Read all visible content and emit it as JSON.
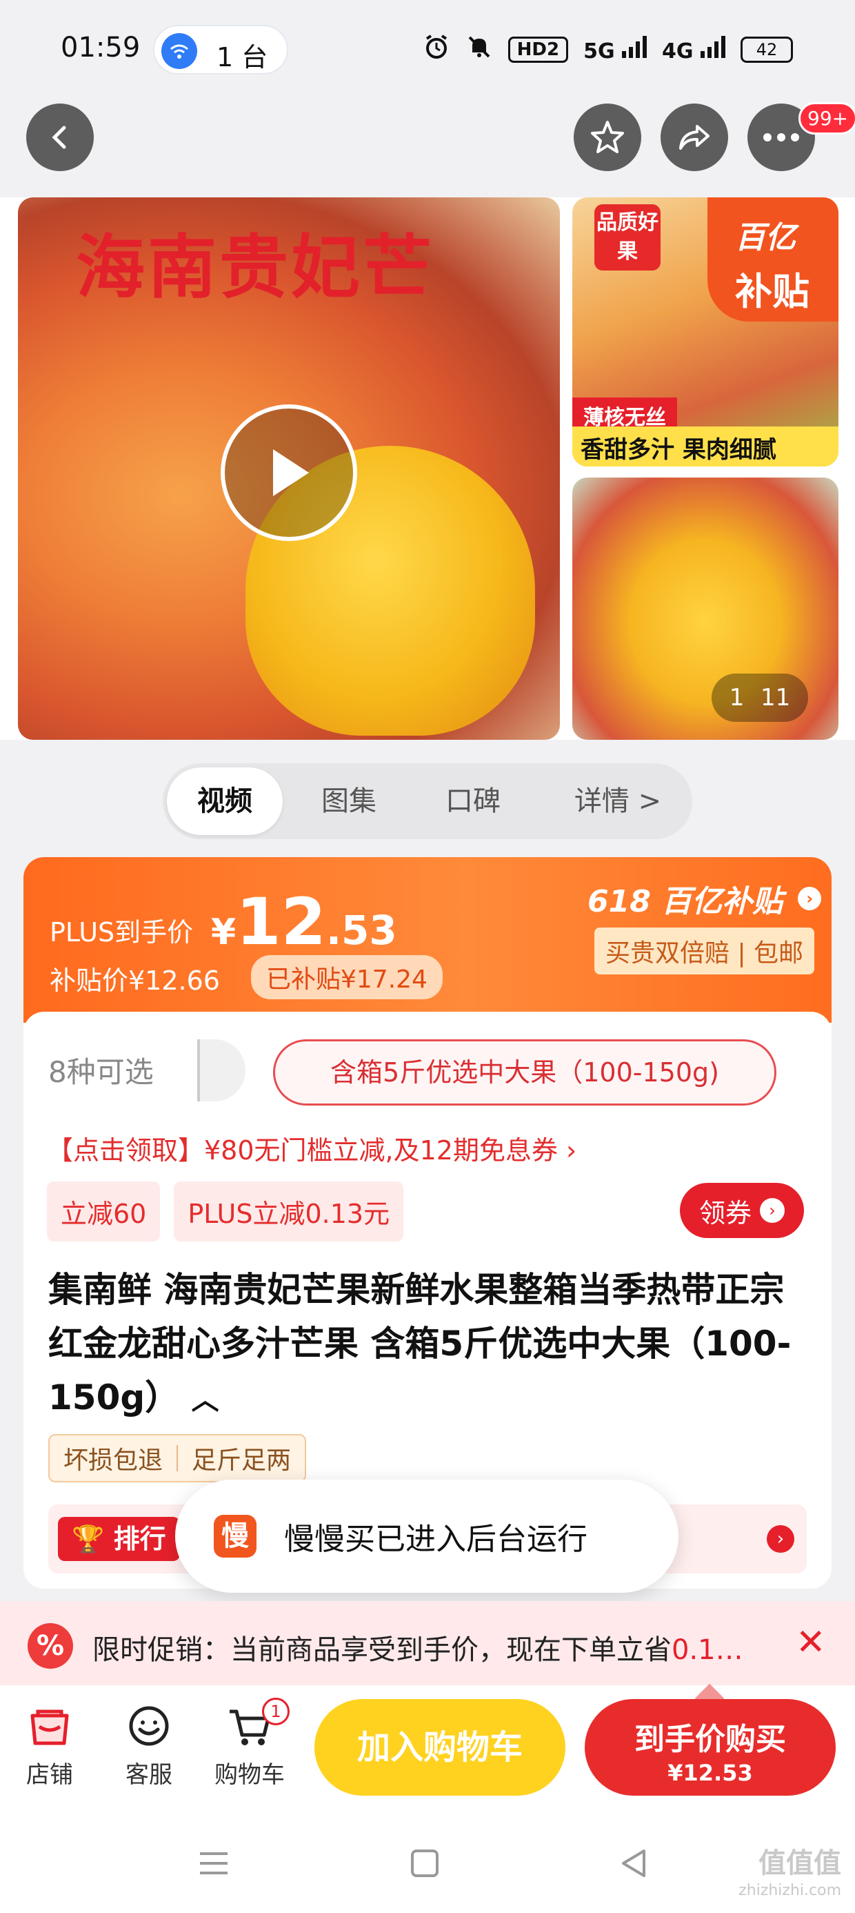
{
  "status_bar": {
    "time": "01:59",
    "hotspot": "1 台",
    "hd": "HD2",
    "signal1": "5G",
    "signal2": "4G",
    "battery": "42"
  },
  "nav": {
    "more_badge": "99+"
  },
  "gallery": {
    "main_title": "海南贵妃芒",
    "side1_quality": "品质好果",
    "side1_subsidy_l1": "百亿",
    "side1_subsidy_l2": "补贴",
    "side1_thin": "薄核无丝",
    "side1_juicy": "香甜多汁 果肉细腻",
    "counter_current": "1",
    "counter_total": "11"
  },
  "media_tabs": [
    "视频",
    "图集",
    "口碑",
    "详情 >"
  ],
  "price": {
    "plus_label": "PLUS到手价",
    "currency": "¥",
    "price_int": "12",
    "price_dec": ".53",
    "subsidy_price": "补贴价¥12.66",
    "subsidized_chip": "已补贴¥17.24",
    "event_tag": "618 百亿补贴",
    "guarantee": "买贵双倍赔 | 包邮"
  },
  "variants": {
    "count": "8种可选",
    "selected": "含箱5斤优选中大果（100-150g)"
  },
  "coupon_link": "【点击领取】¥80无门槛立减,及12期免息券 ›",
  "tags": [
    "立减60",
    "PLUS立减0.13元"
  ],
  "claim_button": "领券",
  "product_title": "集南鲜 海南贵妃芒果新鲜水果整箱当季热带正宗红金龙甜心多汁芒果 含箱5斤优选中大果（100-150g）",
  "features": [
    "坏损包退",
    "足斤足两"
  ],
  "rank_tag": "排行",
  "toast": {
    "icon": "慢",
    "text": "慢慢买已进入后台运行"
  },
  "promo": {
    "icon": "%",
    "text": "限时促销：当前商品享受到手价，现在下单立省",
    "highlight": "0.1…"
  },
  "bottom": {
    "store": "店铺",
    "service": "客服",
    "cart": "购物车",
    "cart_badge": "1",
    "add_to_cart": "加入购物车",
    "buy_l1": "到手价购买",
    "buy_l2": "¥12.53"
  },
  "watermark": {
    "brand": "值值值",
    "url": "zhizhizhi.com"
  }
}
